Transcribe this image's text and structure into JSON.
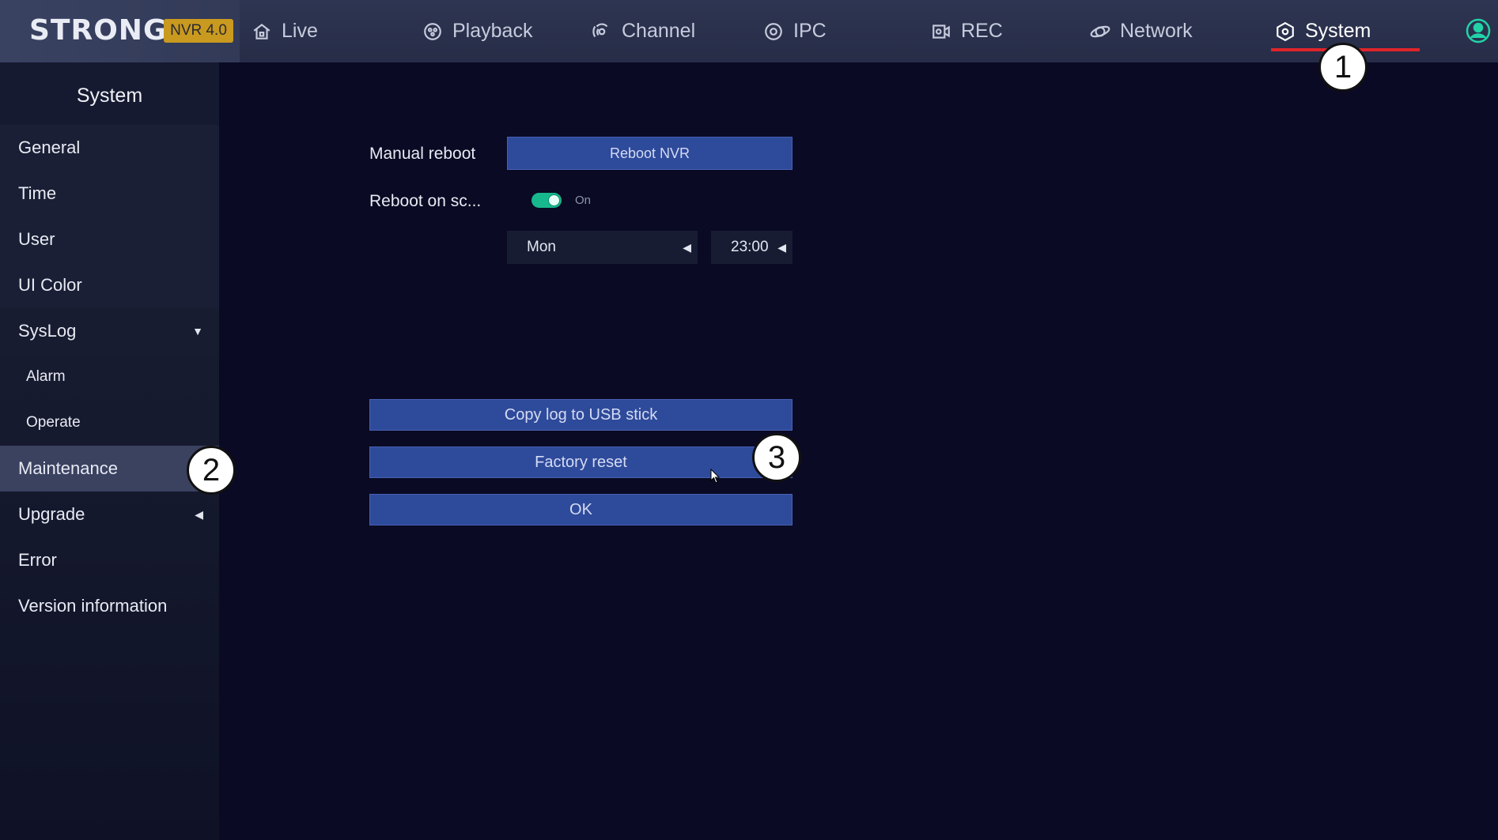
{
  "brand": {
    "logo": "STRONG",
    "badge": "NVR 4.0"
  },
  "nav": {
    "tabs": [
      {
        "label": "Live",
        "icon": "home-icon"
      },
      {
        "label": "Playback",
        "icon": "playback-icon"
      },
      {
        "label": "Channel",
        "icon": "channel-icon"
      },
      {
        "label": "IPC",
        "icon": "ipc-icon"
      },
      {
        "label": "REC",
        "icon": "rec-icon"
      },
      {
        "label": "Network",
        "icon": "network-icon"
      },
      {
        "label": "System",
        "icon": "system-icon"
      }
    ],
    "active": "System"
  },
  "sidebar": {
    "title": "System",
    "items": [
      {
        "label": "General"
      },
      {
        "label": "Time"
      },
      {
        "label": "User"
      },
      {
        "label": "UI  Color"
      },
      {
        "label": "SysLog"
      },
      {
        "label": "Alarm"
      },
      {
        "label": "Operate"
      },
      {
        "label": "Maintenance"
      },
      {
        "label": "Upgrade"
      },
      {
        "label": "Error"
      },
      {
        "label": "Version  information"
      }
    ],
    "selected": "Maintenance"
  },
  "main": {
    "manual_reboot_label": "Manual  reboot",
    "reboot_button": "Reboot  NVR",
    "schedule_label": "Reboot  on  sc...",
    "schedule_toggle": "On",
    "day_value": "Mon",
    "time_value": "23:00",
    "copy_log_button": "Copy  log  to  USB  stick",
    "factory_reset_button": "Factory  reset",
    "ok_button": "OK"
  },
  "callouts": [
    "1",
    "2",
    "3"
  ],
  "colors": {
    "accent_button": "#2e4a9a",
    "active_underline": "#e0242a",
    "toggle_on": "#17b88d",
    "badge": "#c99a1f"
  }
}
